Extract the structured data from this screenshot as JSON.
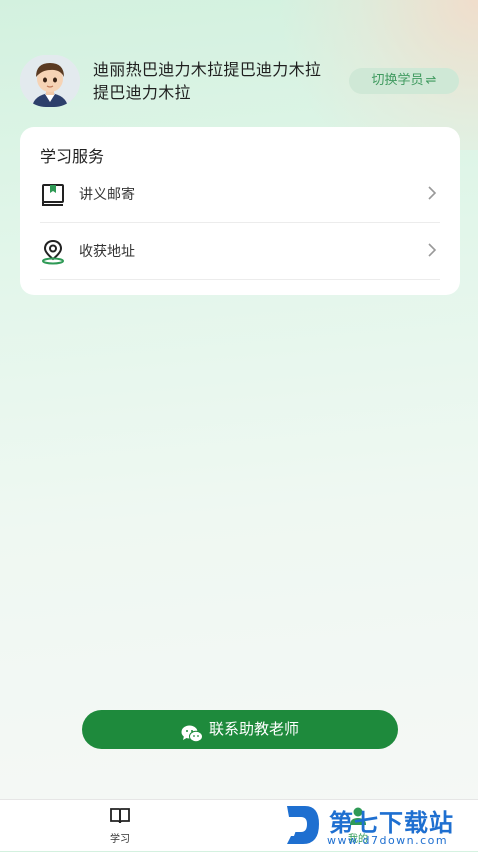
{
  "header": {
    "student_name": "迪丽热巴迪力木拉提巴迪力木拉提巴迪力木拉",
    "switch_label": "切换学员",
    "switch_icon": "swap-arrows-icon",
    "avatar_icon": "student-avatar"
  },
  "services": {
    "title": "学习服务",
    "items": [
      {
        "label": "讲义邮寄",
        "icon": "book-icon"
      },
      {
        "label": "收获地址",
        "icon": "location-pin-icon"
      }
    ]
  },
  "contact_button": {
    "label": "联系助教老师",
    "icon": "wechat-icon"
  },
  "tabbar": {
    "tabs": [
      {
        "label": "学习",
        "icon": "book-open-icon",
        "active": false
      },
      {
        "label": "我的",
        "icon": "user-icon",
        "active": true
      }
    ]
  },
  "watermark": {
    "text": "第七下载站",
    "url": "www.d7down.com"
  },
  "colors": {
    "primary": "#1e8a3c",
    "accent_text": "#3f9a5f",
    "switch_bg": "#cfe8d6",
    "watermark": "#1e6fd0"
  }
}
